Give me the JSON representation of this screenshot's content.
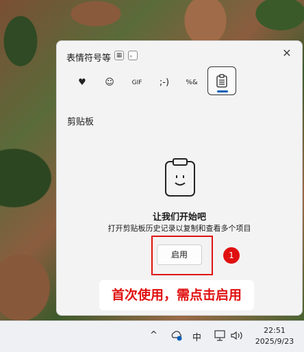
{
  "panel": {
    "title": "表情符号等",
    "grid_label": "▦",
    "dot_label": "。",
    "close_glyph": "✕",
    "tabs": [
      {
        "id": "heart",
        "glyph": "♥"
      },
      {
        "id": "emoji",
        "glyph": "☺"
      },
      {
        "id": "gif",
        "glyph": "GIF"
      },
      {
        "id": "kaomoji",
        "glyph": ";-)"
      },
      {
        "id": "symbols",
        "glyph": "%&"
      },
      {
        "id": "clipboard",
        "glyph": "📋"
      }
    ],
    "section_title": "剪贴板",
    "empty_heading": "让我们开始吧",
    "empty_desc": "打开剪贴板历史记录以复制和查看多个项目",
    "enable_label": "启用"
  },
  "annotation": {
    "badge": "1",
    "callout": "首次使用，需点击启用",
    "color": "#e01010"
  },
  "taskbar": {
    "chevron": "^",
    "ime": "中",
    "time": "22:51",
    "date": "2025/9/23"
  }
}
